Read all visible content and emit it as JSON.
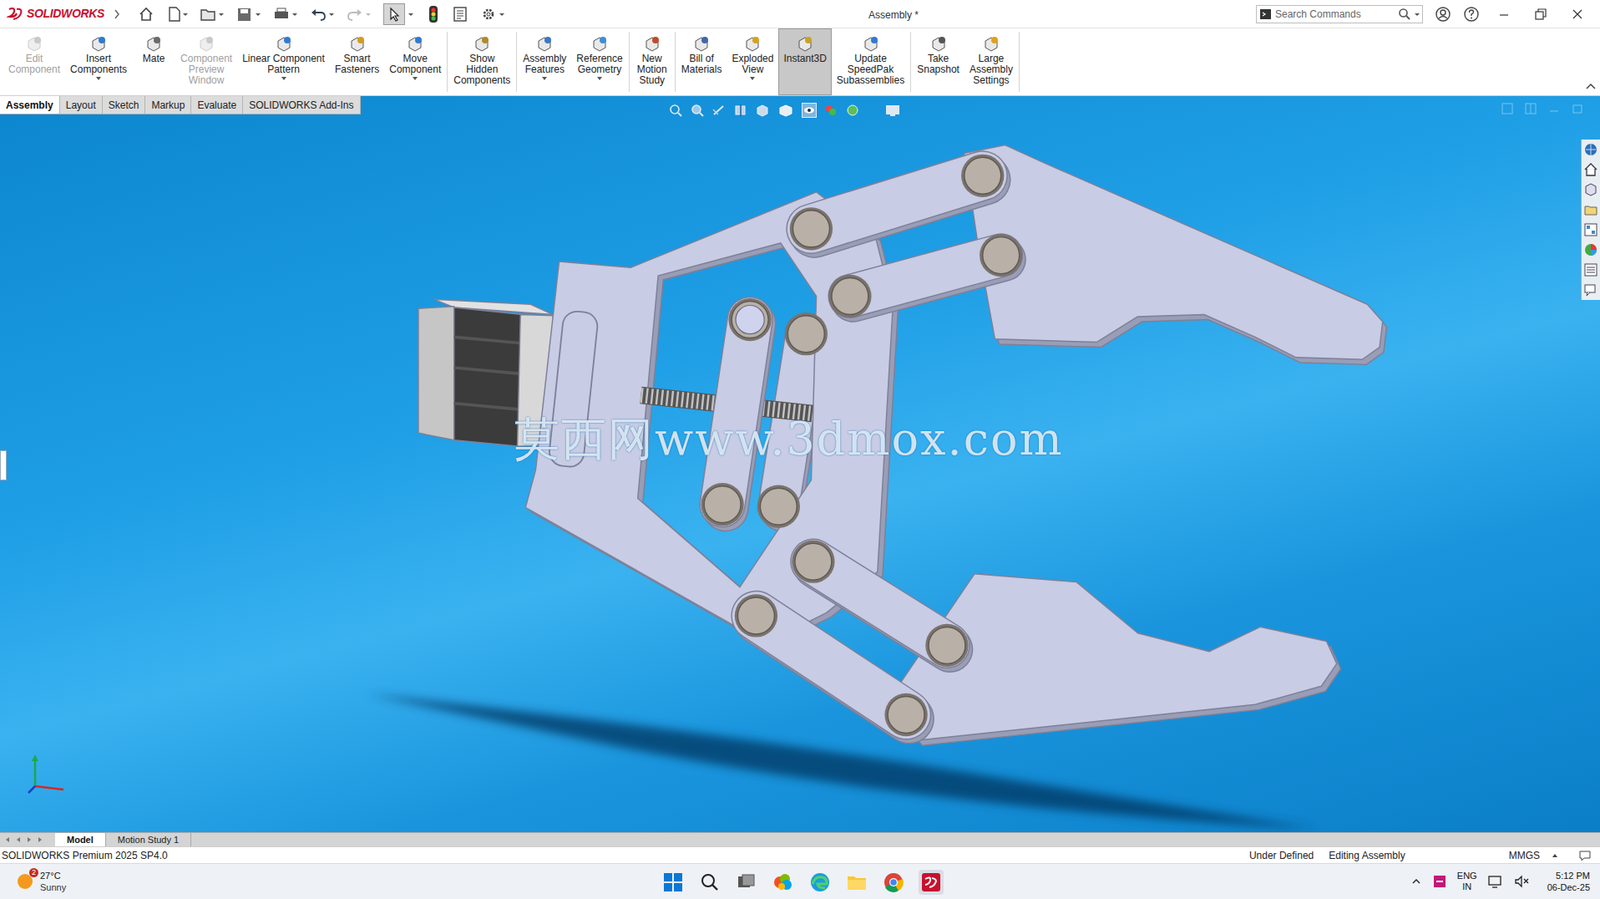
{
  "app": {
    "logo": "SOLIDWORKS",
    "title": "Assembly *",
    "search": {
      "placeholder": "Search Commands"
    }
  },
  "ribbon": [
    {
      "lines": [
        "Edit",
        "Component"
      ],
      "disabled": true,
      "menu": false,
      "selected": false
    },
    {
      "lines": [
        "Insert",
        "Components"
      ],
      "disabled": false,
      "menu": true,
      "selected": false
    },
    {
      "lines": [
        "Mate"
      ],
      "disabled": false,
      "menu": false,
      "selected": false
    },
    {
      "lines": [
        "Component",
        "Preview",
        "Window"
      ],
      "disabled": true,
      "menu": false,
      "selected": false
    },
    {
      "lines": [
        "Linear Component",
        "Pattern"
      ],
      "disabled": false,
      "menu": true,
      "selected": false
    },
    {
      "lines": [
        "Smart",
        "Fasteners"
      ],
      "disabled": false,
      "menu": false,
      "selected": false
    },
    {
      "lines": [
        "Move",
        "Component"
      ],
      "disabled": false,
      "menu": true,
      "selected": false
    },
    {
      "lines": [
        "Show",
        "Hidden",
        "Components"
      ],
      "disabled": false,
      "menu": false,
      "selected": false
    },
    {
      "lines": [
        "Assembly",
        "Features"
      ],
      "disabled": false,
      "menu": true,
      "selected": false
    },
    {
      "lines": [
        "Reference",
        "Geometry"
      ],
      "disabled": false,
      "menu": true,
      "selected": false
    },
    {
      "lines": [
        "New",
        "Motion",
        "Study"
      ],
      "disabled": false,
      "menu": false,
      "selected": false
    },
    {
      "lines": [
        "Bill of",
        "Materials"
      ],
      "disabled": false,
      "menu": false,
      "selected": false
    },
    {
      "lines": [
        "Exploded",
        "View"
      ],
      "disabled": false,
      "menu": true,
      "selected": false
    },
    {
      "lines": [
        "Instant3D"
      ],
      "disabled": false,
      "menu": false,
      "selected": true
    },
    {
      "lines": [
        "Update",
        "SpeedPak",
        "Subassemblies"
      ],
      "disabled": false,
      "menu": false,
      "selected": false
    },
    {
      "lines": [
        "Take",
        "Snapshot"
      ],
      "disabled": false,
      "menu": false,
      "selected": false
    },
    {
      "lines": [
        "Large",
        "Assembly",
        "Settings"
      ],
      "disabled": false,
      "menu": false,
      "selected": false
    }
  ],
  "tabs": [
    {
      "label": "Assembly",
      "selected": true
    },
    {
      "label": "Layout",
      "selected": false
    },
    {
      "label": "Sketch",
      "selected": false
    },
    {
      "label": "Markup",
      "selected": false
    },
    {
      "label": "Evaluate",
      "selected": false
    },
    {
      "label": "SOLIDWORKS Add-Ins",
      "selected": false
    }
  ],
  "viewport": {
    "watermark": "莫西网www.3dmox.com"
  },
  "sheet_tabs": [
    {
      "label": "Model",
      "selected": true
    },
    {
      "label": "Motion Study 1",
      "selected": false
    }
  ],
  "status_bar": {
    "product": "SOLIDWORKS Premium 2025 SP4.0",
    "state": "Under Defined",
    "mode": "Editing Assembly",
    "units": "MMGS"
  },
  "taskbar": {
    "weather": {
      "badge": "2",
      "temp": "27°C",
      "condition": "Sunny"
    },
    "language": [
      "ENG",
      "IN"
    ],
    "time": "5:12 PM",
    "date": "06-Dec-25"
  }
}
